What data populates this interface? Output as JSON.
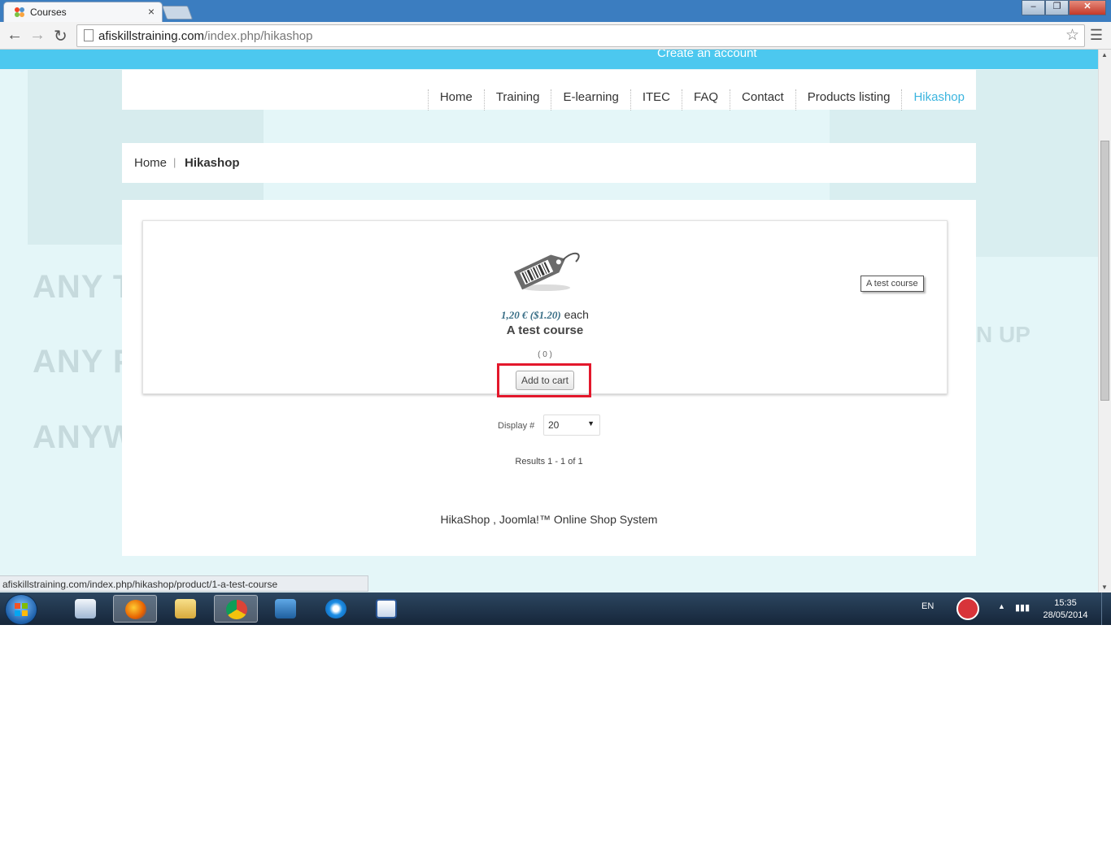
{
  "browser": {
    "tab_title": "Courses",
    "tab_close": "×",
    "url_host": "afiskillstraining.com",
    "url_path": "/index.php/hikashop",
    "window_buttons": [
      "‒",
      "❐",
      "✕"
    ]
  },
  "site": {
    "create_account": "Create an account",
    "menu": [
      "Home",
      "Training",
      "E-learning",
      "ITEC",
      "FAQ",
      "Contact",
      "Products listing",
      "Hikashop"
    ],
    "active_menu": "Hikashop",
    "background_texts": [
      "ANY TI",
      "ANY PL",
      "ANYW"
    ],
    "background_right_text": "N UP"
  },
  "breadcrumb": {
    "home": "Home",
    "separator": "|",
    "current": "Hikashop"
  },
  "product": {
    "price": "1,20 € ($1.20)",
    "price_suffix": " each",
    "name": "A test course",
    "rating": "( 0 )",
    "add_to_cart": "Add to cart",
    "side_tag": "A test course"
  },
  "listing": {
    "display_label": "Display #",
    "display_value": "20",
    "results": "Results 1 - 1 of 1"
  },
  "footer": {
    "text": "HikaShop , Joomla!™ Online Shop System"
  },
  "status_bar": {
    "url": "afiskillstraining.com/index.php/hikashop/product/1-a-test-course"
  },
  "taskbar": {
    "language": "EN",
    "time": "15:35",
    "date": "28/05/2014"
  },
  "colors": {
    "accent": "#4cc8ef",
    "active_menu": "#3cb5df",
    "highlight_border": "#e3182c",
    "price": "#3a6f87"
  }
}
